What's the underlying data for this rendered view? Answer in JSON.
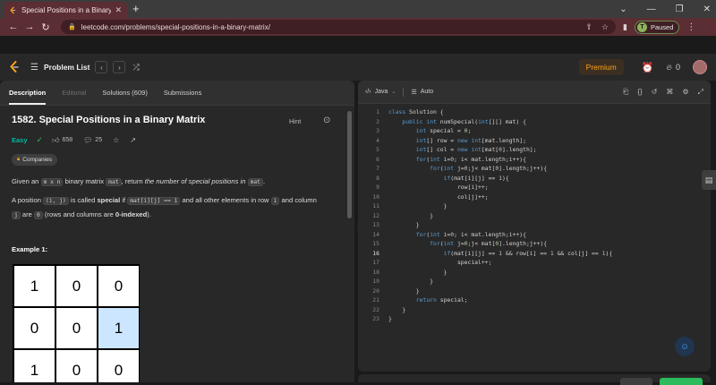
{
  "browser": {
    "tab_title": "Special Positions in a Binary Matr",
    "tab_close": "✕",
    "new_tab": "+",
    "url": "leetcode.com/problems/special-positions-in-a-binary-matrix/",
    "profile_initial": "T",
    "profile_status": "Paused"
  },
  "header": {
    "problem_list": "Problem List",
    "premium": "Premium",
    "streak_count": "0"
  },
  "tabs": {
    "description": "Description",
    "editorial": "Editorial",
    "solutions": "Solutions (609)",
    "submissions": "Submissions"
  },
  "problem": {
    "title": "1582. Special Positions in a Binary Matrix",
    "hint": "Hint",
    "difficulty": "Easy",
    "likes": "658",
    "comments": "25",
    "companies": "Companies",
    "p1_a": "Given an ",
    "p1_code1": "m x n",
    "p1_b": " binary matrix ",
    "p1_code2": "mat",
    "p1_c": ", return ",
    "p1_em": "the number of special positions in",
    "p1_d": " ",
    "p1_code3": "mat",
    "p1_e": ".",
    "p2_a": "A position ",
    "p2_code1": "(i, j)",
    "p2_b": " is called ",
    "p2_strong": "special",
    "p2_c": " if ",
    "p2_code2": "mat[i][j] == 1",
    "p2_d": " and all other elements in row ",
    "p2_code3": "i",
    "p2_e": " and column ",
    "p2_code4": "j",
    "p2_f": " are ",
    "p2_code5": "0",
    "p2_g": " (rows and columns are ",
    "p2_strong2": "0-indexed",
    "p2_h": ").",
    "example_label": "Example 1:",
    "grid": [
      [
        "1",
        "0",
        "0"
      ],
      [
        "0",
        "0",
        "1"
      ],
      [
        "1",
        "0",
        "0"
      ]
    ]
  },
  "editor": {
    "language": "Java",
    "mode": "Auto",
    "lines": [
      "class Solution {",
      "    public int numSpecial(int[][] mat) {",
      "        int special = 0;",
      "        int[] row = new int[mat.length];",
      "        int[] col = new int[mat[0].length];",
      "        for(int i=0; i< mat.length;i++){",
      "            for(int j=0;j< mat[0].length;j++){",
      "                if(mat[i][j] == 1){",
      "                    row[i]++;",
      "                    col[j]++;",
      "                }",
      "            }",
      "        }",
      "        for(int i=0; i< mat.length;i++){",
      "            for(int j=0;j< mat[0].length;j++){",
      "                if(mat[i][j] == 1 && row[i] == 1 && col[j] == 1){",
      "                    special++;",
      "                }",
      "            }",
      "        }",
      "        return special;",
      "    }",
      "}"
    ]
  }
}
